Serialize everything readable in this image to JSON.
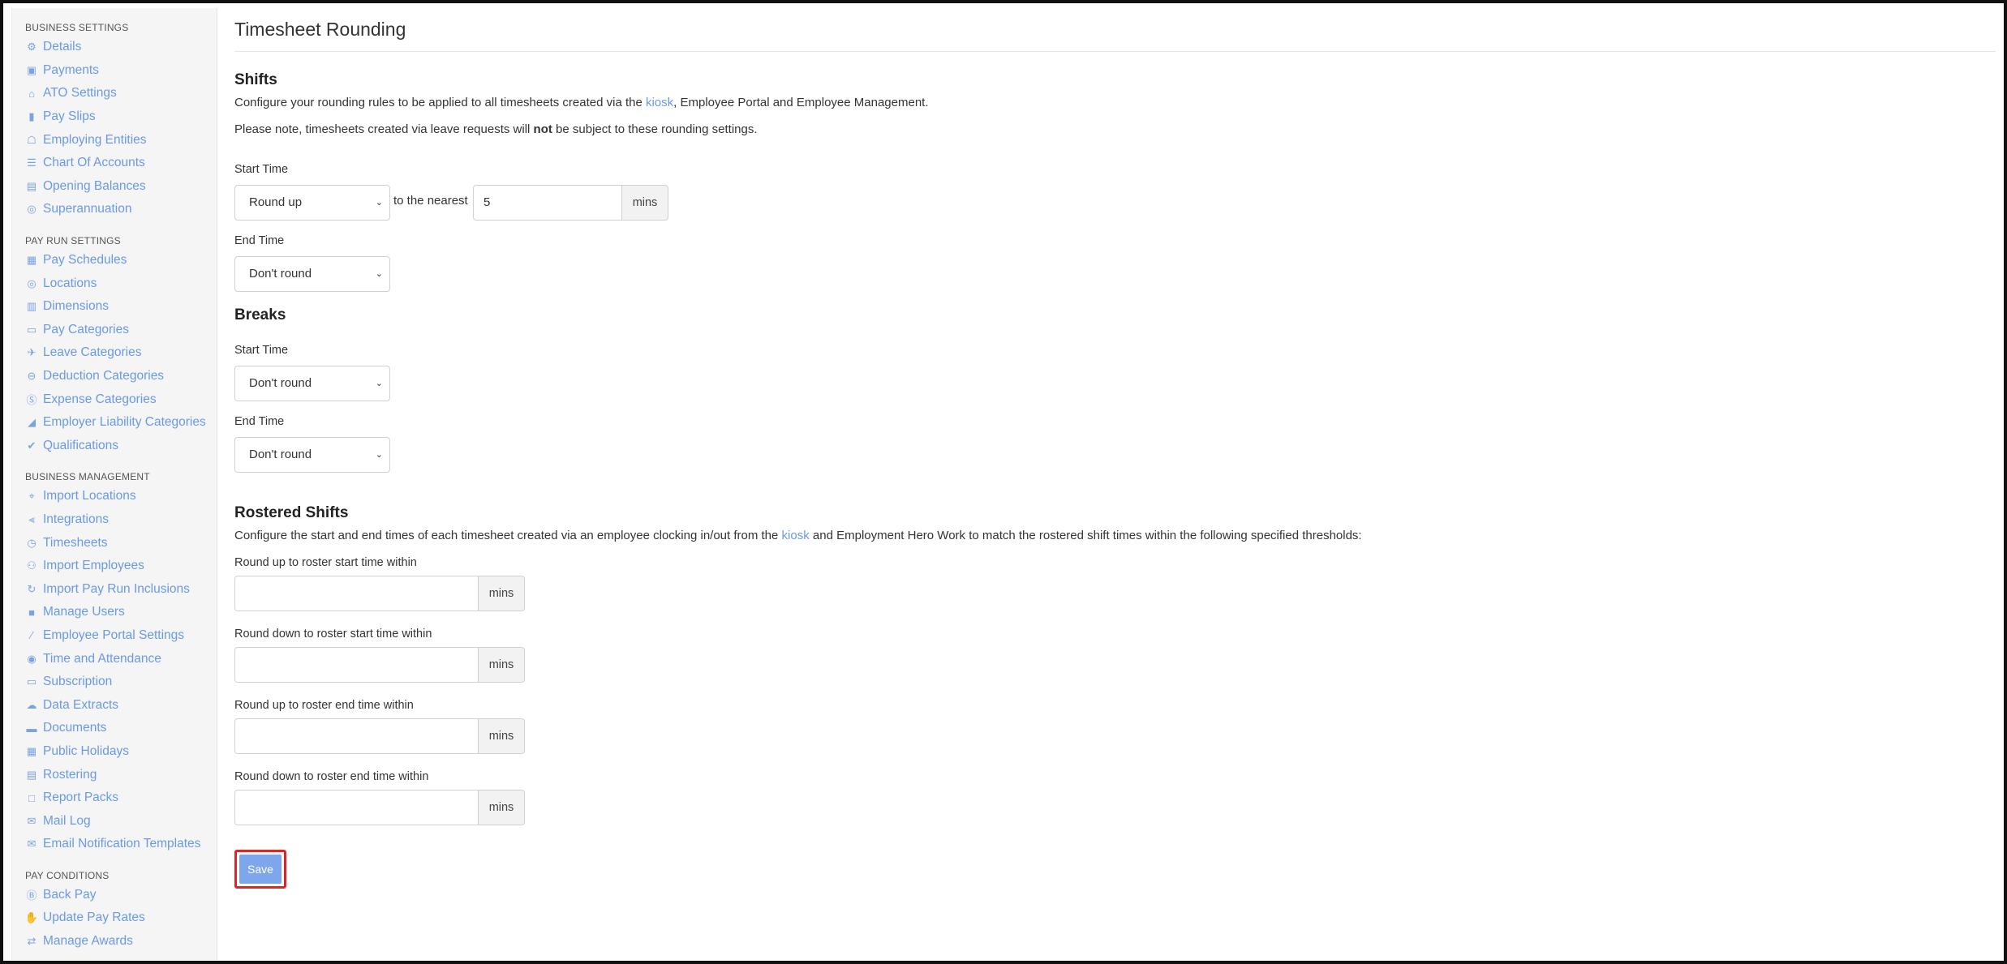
{
  "sidebar": {
    "sections": [
      {
        "title": "BUSINESS SETTINGS",
        "items": [
          {
            "label": "Details",
            "icon": "gear-icon"
          },
          {
            "label": "Payments",
            "icon": "save-icon"
          },
          {
            "label": "ATO Settings",
            "icon": "bank-user-icon"
          },
          {
            "label": "Pay Slips",
            "icon": "file-icon"
          },
          {
            "label": "Employing Entities",
            "icon": "building-icon"
          },
          {
            "label": "Chart Of Accounts",
            "icon": "list-icon"
          },
          {
            "label": "Opening Balances",
            "icon": "ledger-icon"
          },
          {
            "label": "Superannuation",
            "icon": "globe-icon"
          }
        ]
      },
      {
        "title": "PAY RUN SETTINGS",
        "items": [
          {
            "label": "Pay Schedules",
            "icon": "calendar-icon"
          },
          {
            "label": "Locations",
            "icon": "globe-icon"
          },
          {
            "label": "Dimensions",
            "icon": "chart-box-icon"
          },
          {
            "label": "Pay Categories",
            "icon": "money-icon"
          },
          {
            "label": "Leave Categories",
            "icon": "plane-icon"
          },
          {
            "label": "Deduction Categories",
            "icon": "minus-circle-icon"
          },
          {
            "label": "Expense Categories",
            "icon": "dollar-circle-icon"
          },
          {
            "label": "Employer Liability Categories",
            "icon": "area-chart-icon"
          },
          {
            "label": "Qualifications",
            "icon": "check-icon"
          }
        ]
      },
      {
        "title": "BUSINESS MANAGEMENT",
        "items": [
          {
            "label": "Import Locations",
            "icon": "map-pin-icon"
          },
          {
            "label": "Integrations",
            "icon": "integration-icon"
          },
          {
            "label": "Timesheets",
            "icon": "clock-icon"
          },
          {
            "label": "Import Employees",
            "icon": "people-icon"
          },
          {
            "label": "Import Pay Run Inclusions",
            "icon": "refresh-icon"
          },
          {
            "label": "Manage Users",
            "icon": "lock-icon"
          },
          {
            "label": "Employee Portal Settings",
            "icon": "magic-wand-icon"
          },
          {
            "label": "Time and Attendance",
            "icon": "user-circle-icon"
          },
          {
            "label": "Subscription",
            "icon": "credit-card-icon"
          },
          {
            "label": "Data Extracts",
            "icon": "cloud-download-icon"
          },
          {
            "label": "Documents",
            "icon": "folder-icon"
          },
          {
            "label": "Public Holidays",
            "icon": "calendar-icon"
          },
          {
            "label": "Rostering",
            "icon": "roster-icon"
          },
          {
            "label": "Report Packs",
            "icon": "folder-open-icon"
          },
          {
            "label": "Mail Log",
            "icon": "envelope-icon"
          },
          {
            "label": "Email Notification Templates",
            "icon": "envelope-filled-icon"
          }
        ]
      },
      {
        "title": "PAY CONDITIONS",
        "items": [
          {
            "label": "Back Pay",
            "icon": "back-pay-icon"
          },
          {
            "label": "Update Pay Rates",
            "icon": "hand-money-icon"
          },
          {
            "label": "Manage Awards",
            "icon": "exchange-icon"
          }
        ]
      }
    ]
  },
  "page": {
    "title": "Timesheet Rounding"
  },
  "shifts": {
    "heading": "Shifts",
    "desc_pre": "Configure your rounding rules to be applied to all timesheets created via the ",
    "desc_link": "kiosk",
    "desc_post": ", Employee Portal and Employee Management.",
    "note_pre": "Please note, timesheets created via leave requests will ",
    "note_bold": "not",
    "note_post": " be subject to these rounding settings.",
    "start_label": "Start Time",
    "start_value": "Round up",
    "nearest_label": "to the nearest",
    "nearest_value": "5",
    "nearest_unit": "mins",
    "end_label": "End Time",
    "end_value": "Don't round"
  },
  "breaks": {
    "heading": "Breaks",
    "start_label": "Start Time",
    "start_value": "Don't round",
    "end_label": "End Time",
    "end_value": "Don't round"
  },
  "rostered": {
    "heading": "Rostered Shifts",
    "desc_pre": "Configure the start and end times of each timesheet created via an employee clocking in/out from the ",
    "desc_link": "kiosk",
    "desc_post": " and Employment Hero Work to match the rostered shift times within the following specified thresholds:",
    "fields": [
      {
        "label": "Round up to roster start time within",
        "value": "",
        "unit": "mins"
      },
      {
        "label": "Round down to roster start time within",
        "value": "",
        "unit": "mins"
      },
      {
        "label": "Round up to roster end time within",
        "value": "",
        "unit": "mins"
      },
      {
        "label": "Round down to roster end time within",
        "value": "",
        "unit": "mins"
      }
    ]
  },
  "actions": {
    "save_label": "Save"
  }
}
